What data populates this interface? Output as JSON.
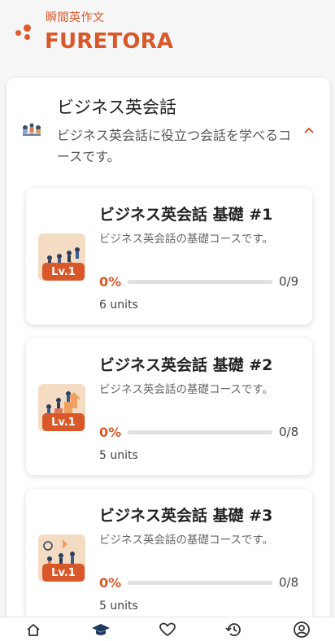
{
  "header": {
    "subtitle": "瞬間英作文",
    "title": "FURETORA"
  },
  "course": {
    "title": "ビジネス英会話",
    "description": "ビジネス英会話に役立つ会話を学べるコースです。"
  },
  "units": [
    {
      "title": "ビジネス英会話 基礎 #1",
      "description": "ビジネス英会話の基礎コースです。",
      "level": "Lv.1",
      "progress_pct": "0%",
      "progress_value": 0,
      "progress_count": "0/9",
      "unit_count": "6 units"
    },
    {
      "title": "ビジネス英会話 基礎 #2",
      "description": "ビジネス英会話の基礎コースです。",
      "level": "Lv.1",
      "progress_pct": "0%",
      "progress_value": 0,
      "progress_count": "0/8",
      "unit_count": "5 units"
    },
    {
      "title": "ビジネス英会話 基礎 #3",
      "description": "ビジネス英会話の基礎コースです。",
      "level": "Lv.1",
      "progress_pct": "0%",
      "progress_value": 0,
      "progress_count": "0/8",
      "unit_count": "5 units"
    }
  ],
  "bottom_nav": [
    {
      "icon": "home-icon"
    },
    {
      "icon": "graduation-cap-icon",
      "active": true
    },
    {
      "icon": "heart-icon"
    },
    {
      "icon": "history-icon"
    },
    {
      "icon": "account-icon"
    }
  ],
  "colors": {
    "accent": "#d9582a",
    "nav_active": "#1f3a5f",
    "background": "#f6f6f6"
  }
}
